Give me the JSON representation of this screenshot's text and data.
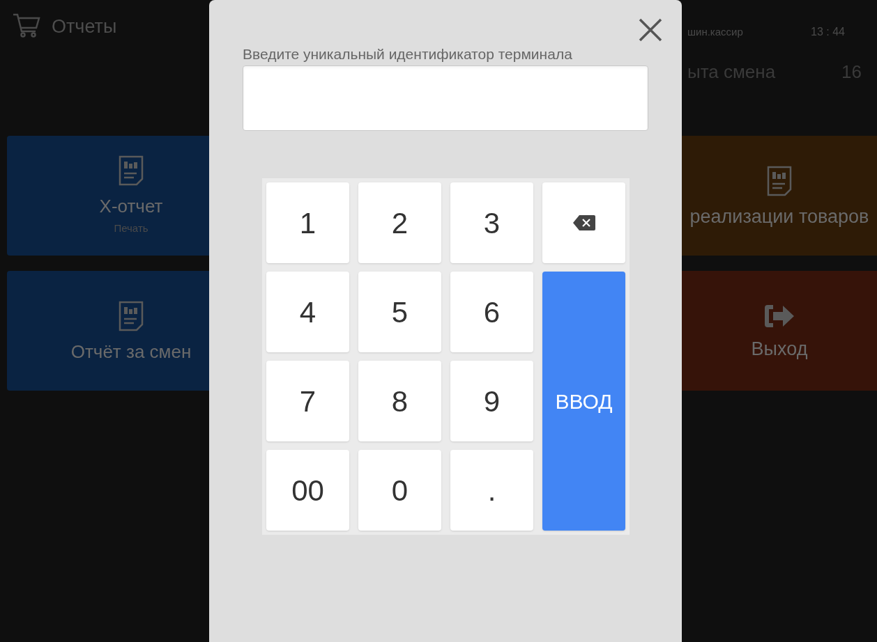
{
  "background": {
    "title": "Отчеты",
    "user": "шин.кассир",
    "time": "13 : 44",
    "shift_status": "ыта смена",
    "shift_number": "16",
    "left_tiles": [
      {
        "kind": "report",
        "title": "X-отчет",
        "subtitle": "Печать",
        "color": "#0a2342"
      },
      {
        "kind": "report",
        "title": "Отчёт за смен",
        "color": "#0a2342"
      }
    ],
    "right_tiles": [
      {
        "kind": "report",
        "title": "реализации товаров",
        "color": "#2e1b06"
      },
      {
        "kind": "exit",
        "title": "Выход",
        "color": "#361309"
      }
    ]
  },
  "dialog": {
    "label": "Введите уникальный идентификатор терминала",
    "keys": [
      {
        "kind": "digit",
        "label": "1"
      },
      {
        "kind": "digit",
        "label": "2"
      },
      {
        "kind": "digit",
        "label": "3"
      },
      {
        "kind": "backspace"
      },
      {
        "kind": "digit",
        "label": "4"
      },
      {
        "kind": "digit",
        "label": "5"
      },
      {
        "kind": "digit",
        "label": "6"
      },
      {
        "kind": "digit",
        "label": "7"
      },
      {
        "kind": "digit",
        "label": "8"
      },
      {
        "kind": "digit",
        "label": "9"
      },
      {
        "kind": "digit",
        "label": "00"
      },
      {
        "kind": "digit",
        "label": "0"
      },
      {
        "kind": "digit",
        "label": "."
      },
      {
        "kind": "enter",
        "label": "ВВОД"
      }
    ]
  }
}
